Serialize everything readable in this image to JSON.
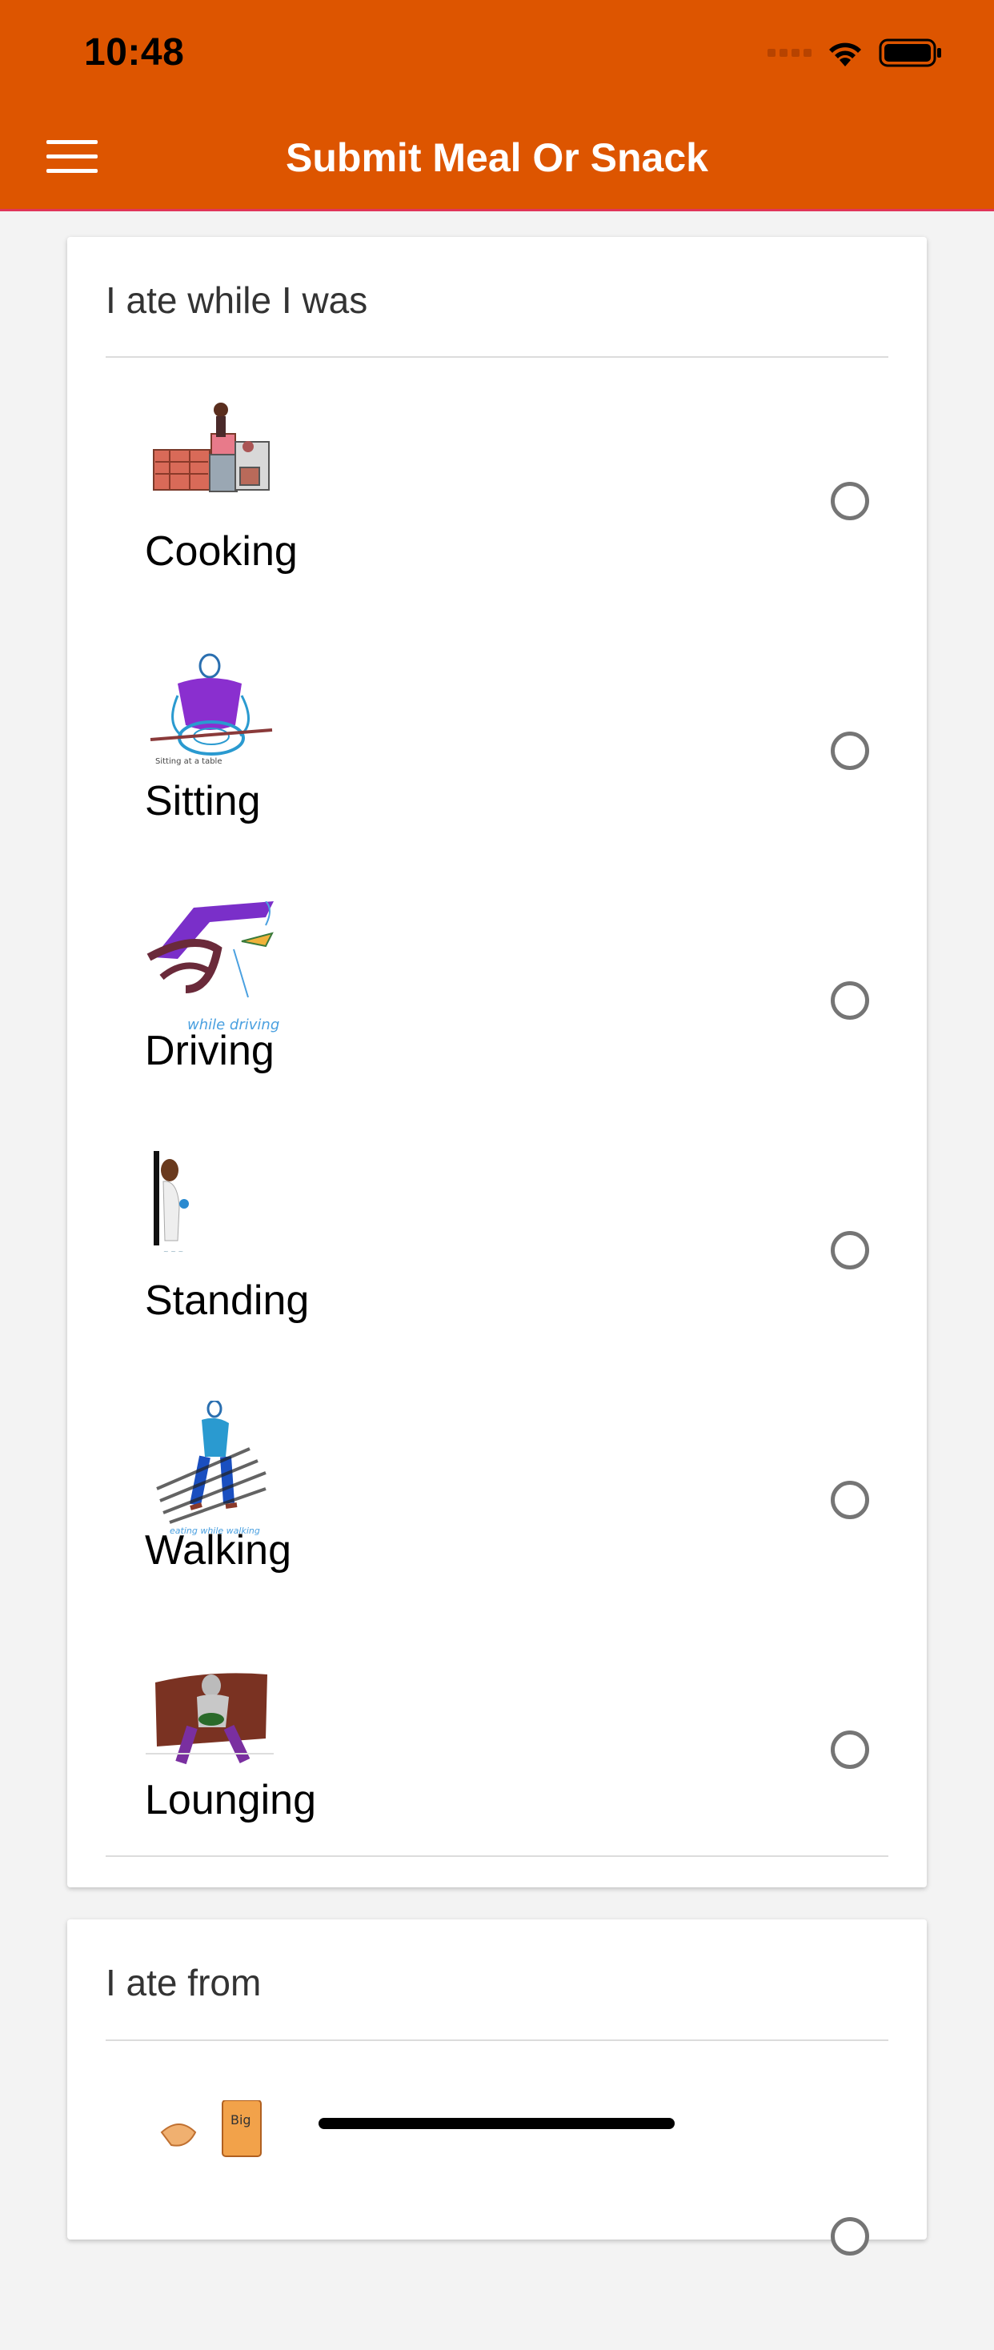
{
  "status_bar": {
    "time": "10:48"
  },
  "header": {
    "title": "Submit Meal Or Snack"
  },
  "section_activity": {
    "title": "I ate while I was",
    "options": [
      {
        "label": "Cooking"
      },
      {
        "label": "Sitting",
        "image_caption": "Sitting at a table"
      },
      {
        "label": "Driving",
        "image_caption": "while driving"
      },
      {
        "label": "Standing"
      },
      {
        "label": "Walking",
        "image_caption": "eating while walking"
      },
      {
        "label": "Lounging"
      }
    ]
  },
  "section_source": {
    "title": "I ate from",
    "first_image_caption": "Big"
  },
  "colors": {
    "header_bg": "#dd5500",
    "header_border": "#e0345a",
    "radio": "#757575",
    "card_bg": "#ffffff",
    "page_bg": "#f3f3f3"
  },
  "icons": [
    "menu-icon",
    "signal-icon",
    "wifi-icon",
    "battery-icon",
    "radio-unselected-icon"
  ]
}
